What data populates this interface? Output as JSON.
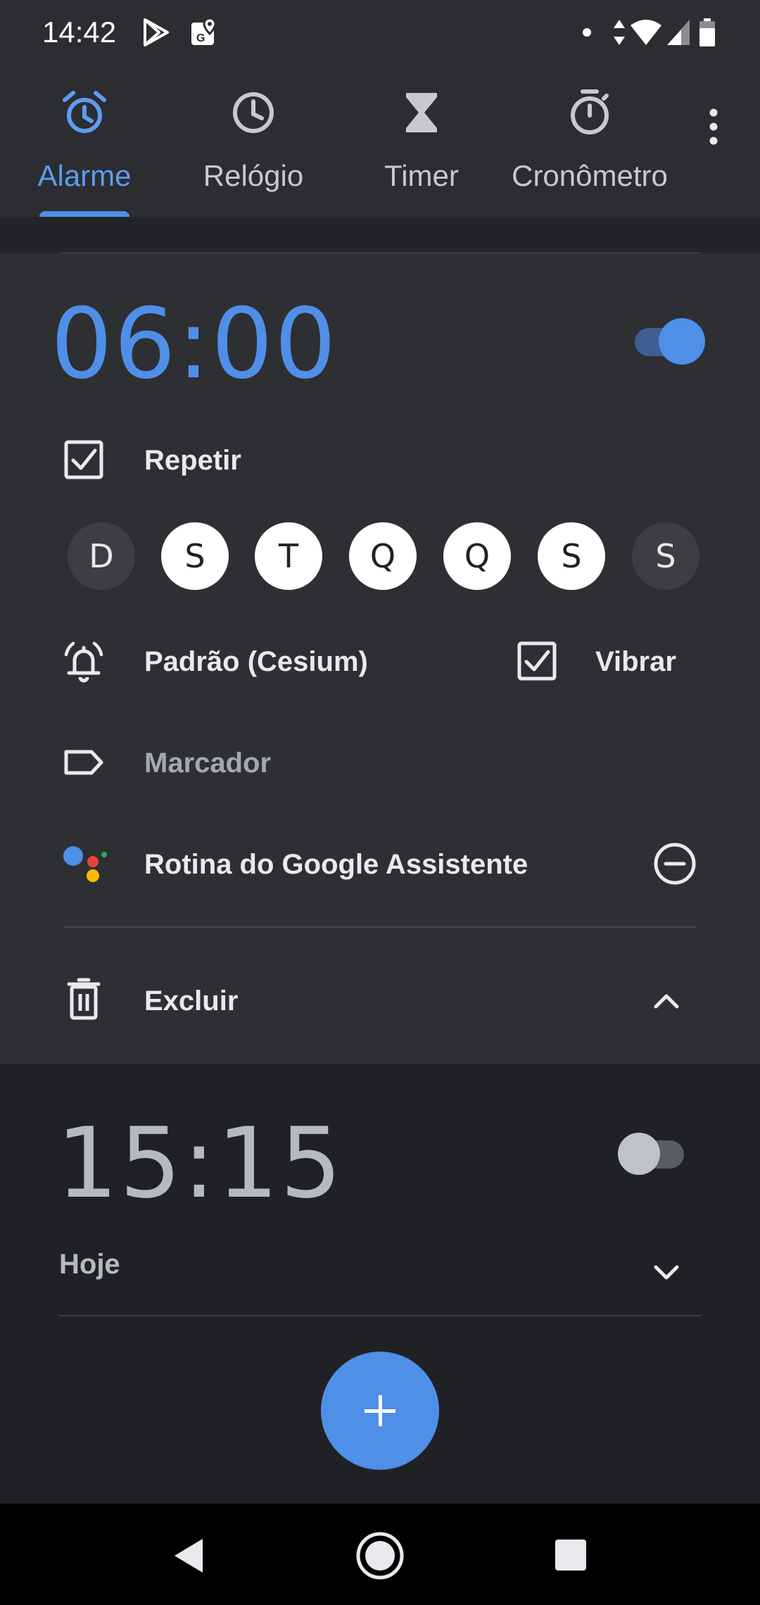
{
  "status_bar": {
    "time": "14:42"
  },
  "tabs": [
    {
      "label": "Alarme",
      "icon": "alarm-icon",
      "active": true
    },
    {
      "label": "Relógio",
      "icon": "clock-icon",
      "active": false
    },
    {
      "label": "Timer",
      "icon": "hourglass-icon",
      "active": false
    },
    {
      "label": "Cronômetro",
      "icon": "stopwatch-icon",
      "active": false
    }
  ],
  "alarms": [
    {
      "time": "06:00",
      "enabled": true,
      "repeat_label": "Repetir",
      "repeat_checked": true,
      "days": [
        {
          "letter": "D",
          "on": false
        },
        {
          "letter": "S",
          "on": true
        },
        {
          "letter": "T",
          "on": true
        },
        {
          "letter": "Q",
          "on": true
        },
        {
          "letter": "Q",
          "on": true
        },
        {
          "letter": "S",
          "on": true
        },
        {
          "letter": "S",
          "on": false
        }
      ],
      "ringtone": "Padrão (Cesium)",
      "vibrate_label": "Vibrar",
      "vibrate_checked": true,
      "label_placeholder": "Marcador",
      "assistant_label": "Rotina do Google Assistente",
      "delete_label": "Excluir"
    },
    {
      "time": "15:15",
      "enabled": false,
      "subtitle": "Hoje"
    }
  ],
  "colors": {
    "accent": "#4f8fe8",
    "background": "#202124",
    "card": "#2d2f33"
  }
}
